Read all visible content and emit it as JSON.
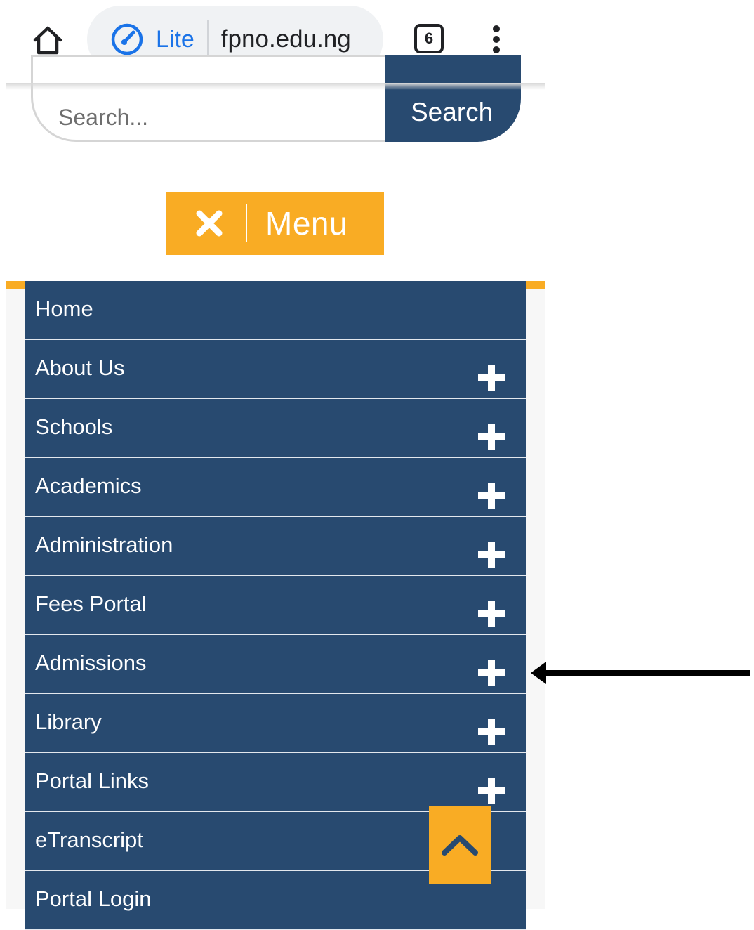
{
  "browser": {
    "lite_label": "Lite",
    "url": "fpno.edu.ng",
    "tab_count": "6",
    "icons": {
      "home": "home-icon",
      "lite": "speedometer-icon",
      "menu": "kebab-menu-icon"
    }
  },
  "search": {
    "placeholder": "Search...",
    "button_label": "Search"
  },
  "menu_toggle": {
    "label": "Menu",
    "icon": "close-icon"
  },
  "nav": {
    "items": [
      {
        "label": "Home",
        "expandable": false
      },
      {
        "label": "About Us",
        "expandable": true
      },
      {
        "label": "Schools",
        "expandable": true
      },
      {
        "label": "Academics",
        "expandable": true
      },
      {
        "label": "Administration",
        "expandable": true
      },
      {
        "label": "Fees Portal",
        "expandable": true
      },
      {
        "label": "Admissions",
        "expandable": true
      },
      {
        "label": "Library",
        "expandable": true
      },
      {
        "label": "Portal Links",
        "expandable": true
      },
      {
        "label": "eTranscript",
        "expandable": false
      },
      {
        "label": "Portal Login",
        "expandable": false
      }
    ]
  },
  "back_to_top": {
    "icon": "chevron-up-icon"
  },
  "annotation": {
    "icon": "arrow-left-icon"
  },
  "colors": {
    "nav_background": "#284a70",
    "accent": "#f9ac24",
    "browser_accent": "#1a73e8"
  }
}
